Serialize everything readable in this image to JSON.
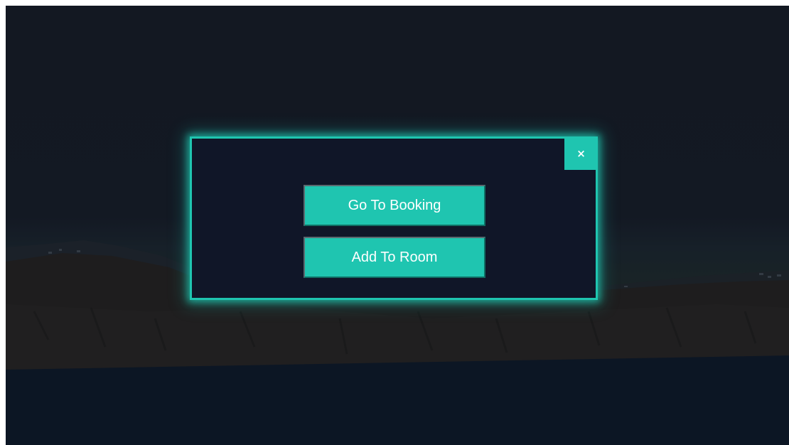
{
  "modal": {
    "close_label": "×",
    "buttons": [
      {
        "label": "Go To Booking"
      },
      {
        "label": "Add To Room"
      }
    ]
  },
  "colors": {
    "accent": "#1fc5b0",
    "modal_bg": "#101628",
    "page_bg": "#1b1f2b",
    "button_text": "#ffffff"
  },
  "icons": {
    "close": "close-icon"
  }
}
